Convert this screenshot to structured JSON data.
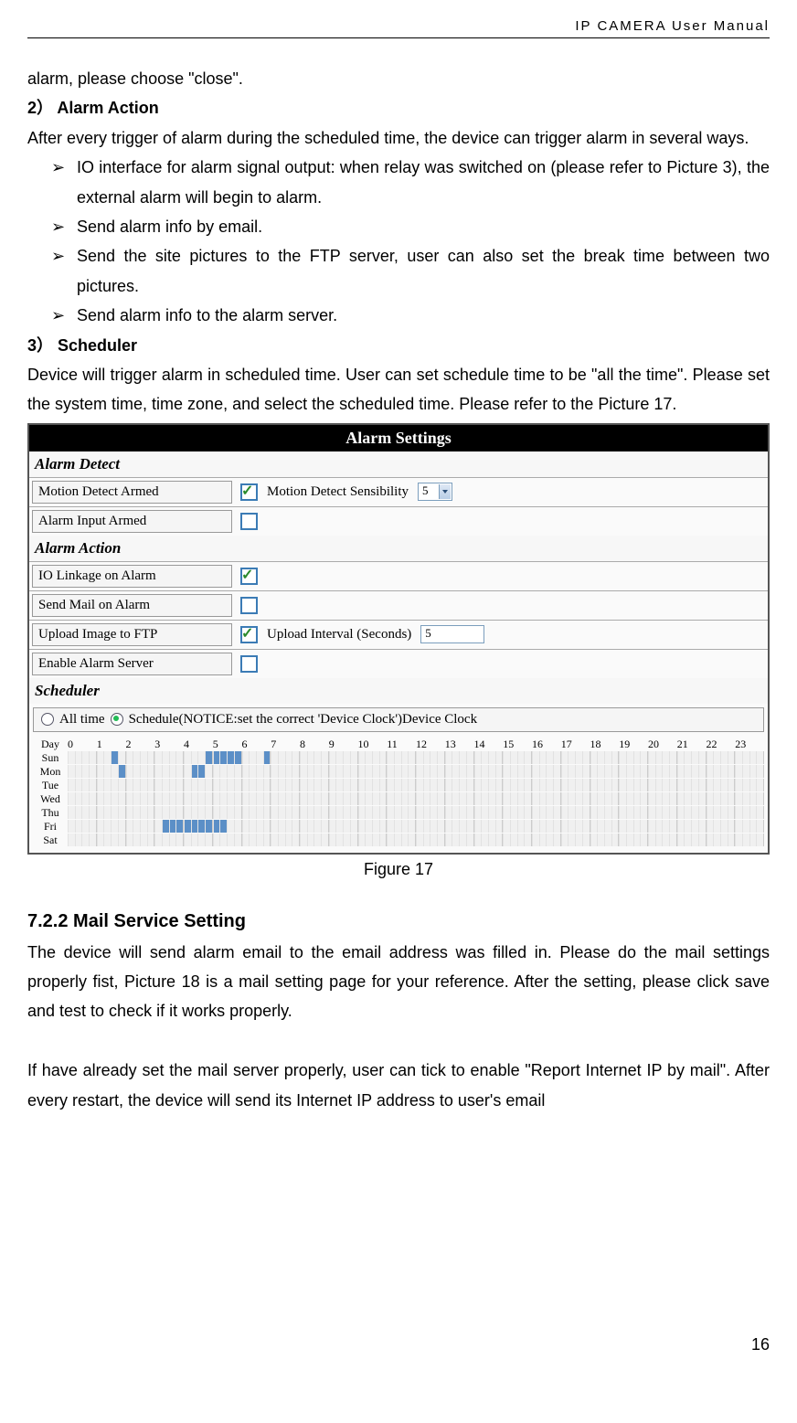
{
  "header": "IP  CAMERA  User  Manual",
  "lead_in": "alarm, please choose \"close\".",
  "section2": {
    "title": "2） Alarm Action",
    "intro": "After every trigger of alarm during the scheduled time, the device can trigger alarm in several ways.",
    "bullets": [
      "IO interface for alarm signal output: when relay was switched on (please refer to Picture 3), the external alarm will begin to alarm.",
      "Send alarm info by email.",
      "Send the site pictures to the FTP server, user can also set the break time between two pictures.",
      "Send alarm info to the alarm server."
    ]
  },
  "section3": {
    "title": "3） Scheduler",
    "text": "Device will trigger alarm in scheduled time. User can set schedule time to be \"all the time\". Please set the system time, time zone, and select the scheduled time. Please refer to the Picture 17."
  },
  "settings": {
    "title": "Alarm Settings",
    "groups": {
      "detect": {
        "header": "Alarm Detect",
        "motion_label": "Motion Detect Armed",
        "motion_checked": true,
        "sens_label": "Motion Detect Sensibility",
        "sens_value": "5",
        "input_label": "Alarm Input Armed",
        "input_checked": false
      },
      "action": {
        "header": "Alarm Action",
        "io_label": "IO Linkage on Alarm",
        "io_checked": true,
        "mail_label": "Send Mail on Alarm",
        "mail_checked": false,
        "ftp_label": "Upload Image to FTP",
        "ftp_checked": true,
        "interval_label": "Upload Interval (Seconds)",
        "interval_value": "5",
        "server_label": "Enable Alarm Server",
        "server_checked": false
      },
      "sched": {
        "header": "Scheduler",
        "all_label": "All time",
        "sched_label": "Schedule(NOTICE:set the correct 'Device Clock')Device Clock",
        "mode": "schedule",
        "hours": [
          "0",
          "1",
          "2",
          "3",
          "4",
          "5",
          "6",
          "7",
          "8",
          "9",
          "10",
          "11",
          "12",
          "13",
          "14",
          "15",
          "16",
          "17",
          "18",
          "19",
          "20",
          "21",
          "22",
          "23"
        ],
        "days": [
          "Day",
          "Sun",
          "Mon",
          "Tue",
          "Wed",
          "Thu",
          "Fri",
          "Sat"
        ],
        "selected": {
          "Sun": [
            [
              1,
              2
            ],
            [
              4,
              3
            ],
            [
              5,
              0
            ],
            [
              5,
              1
            ],
            [
              5,
              2
            ],
            [
              5,
              3
            ],
            [
              6,
              3
            ]
          ],
          "Mon": [
            [
              1,
              3
            ],
            [
              4,
              1
            ],
            [
              4,
              2
            ]
          ],
          "Tue": [],
          "Wed": [],
          "Thu": [],
          "Fri": [
            [
              3,
              1
            ],
            [
              3,
              2
            ],
            [
              3,
              3
            ],
            [
              4,
              0
            ],
            [
              4,
              1
            ],
            [
              4,
              2
            ],
            [
              4,
              3
            ],
            [
              5,
              0
            ],
            [
              5,
              1
            ]
          ],
          "Sat": []
        }
      }
    }
  },
  "figure_caption": "Figure 17",
  "section722": {
    "title": "7.2.2   Mail Service Setting",
    "p1": "The device will send alarm email to the email address was filled in. Please do the mail settings properly fist, Picture 18 is a mail setting page for your reference. After the setting, please click save and test to check if it works properly.",
    "p2": "If have already set the mail server properly, user can tick to enable \"Report Internet IP by mail\". After every restart, the device will send its Internet IP address to user's email"
  },
  "page_number": "16"
}
